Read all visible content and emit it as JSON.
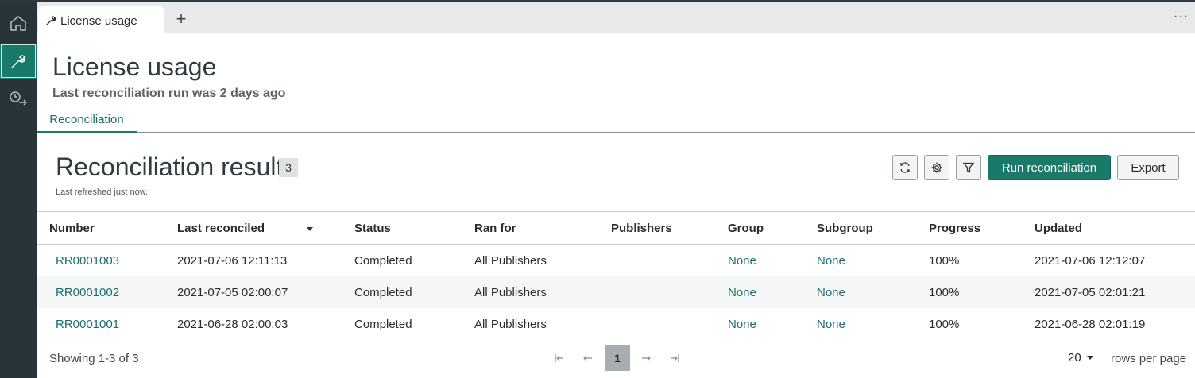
{
  "colors": {
    "accent": "#1a7a6a",
    "link": "#1a6e72",
    "rail": "#283438"
  },
  "rail": {
    "items": [
      {
        "icon": "home-icon"
      },
      {
        "icon": "wrench-icon",
        "active": true
      },
      {
        "icon": "clock-arrow-icon"
      }
    ]
  },
  "tabs": {
    "items": [
      {
        "label": "License usage",
        "icon": "wrench-icon"
      }
    ],
    "new_tab": "+",
    "more": "···"
  },
  "page": {
    "title": "License usage",
    "subtitle": "Last reconciliation run was 2 days ago",
    "subtabs": [
      "Reconciliation"
    ]
  },
  "section": {
    "title": "Reconciliation result",
    "count": "3",
    "refreshed": "Last refreshed just now.",
    "actions": {
      "refresh_icon": "refresh-icon",
      "settings_icon": "gear-icon",
      "filter_icon": "filter-icon",
      "primary": "Run reconciliation",
      "secondary": "Export"
    }
  },
  "table": {
    "columns": [
      "Number",
      "Last reconciled",
      "Status",
      "Ran for",
      "Publishers",
      "Group",
      "Subgroup",
      "Progress",
      "Updated"
    ],
    "rows": [
      {
        "number": "RR0001003",
        "last_reconciled": "2021-07-06 12:11:13",
        "status": "Completed",
        "ran_for": "All Publishers",
        "publishers": "",
        "group": "None",
        "subgroup": "None",
        "progress": "100%",
        "updated": "2021-07-06 12:12:07"
      },
      {
        "number": "RR0001002",
        "last_reconciled": "2021-07-05 02:00:07",
        "status": "Completed",
        "ran_for": "All Publishers",
        "publishers": "",
        "group": "None",
        "subgroup": "None",
        "progress": "100%",
        "updated": "2021-07-05 02:01:21"
      },
      {
        "number": "RR0001001",
        "last_reconciled": "2021-06-28 02:00:03",
        "status": "Completed",
        "ran_for": "All Publishers",
        "publishers": "",
        "group": "None",
        "subgroup": "None",
        "progress": "100%",
        "updated": "2021-06-28 02:01:19"
      }
    ]
  },
  "footer": {
    "showing": "Showing 1-3 of 3",
    "page": "1",
    "rows_per_page_value": "20",
    "rows_per_page_label": "rows per page"
  }
}
